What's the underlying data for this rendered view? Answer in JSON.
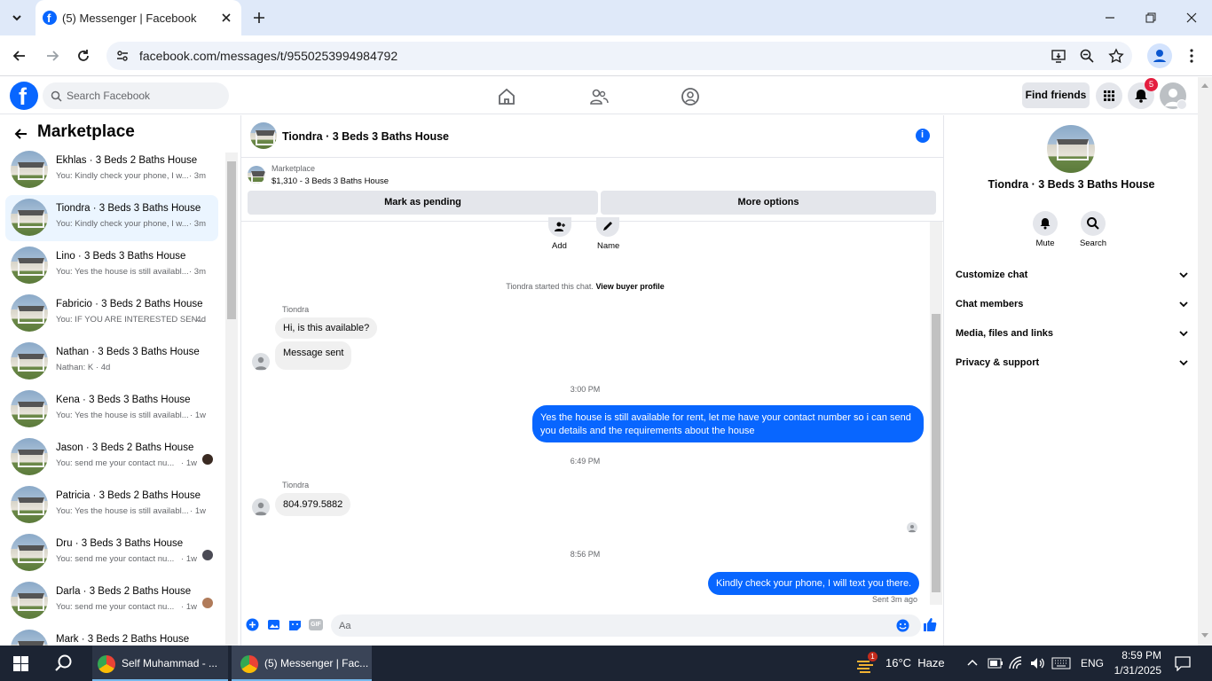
{
  "browser": {
    "tab_title": "(5) Messenger | Facebook",
    "url": "facebook.com/messages/t/9550253994984792"
  },
  "fb": {
    "search_placeholder": "Search Facebook",
    "find_friends": "Find friends",
    "notif_count": "5"
  },
  "left": {
    "title": "Marketplace",
    "conversations": [
      {
        "name": "Ekhlas · 3 Beds 2 Baths House",
        "preview": "You: Kindly check your phone, I w...",
        "time": "· 3m",
        "active": false
      },
      {
        "name": "Tiondra · 3 Beds 3 Baths House",
        "preview": "You: Kindly check your phone, I w...",
        "time": "· 3m",
        "active": true
      },
      {
        "name": "Lino · 3 Beds 3 Baths House",
        "preview": "You: Yes the house is still availabl...",
        "time": "· 3m",
        "active": false
      },
      {
        "name": "Fabricio · 3 Beds 2 Baths House",
        "preview": "You: IF YOU ARE INTERESTED SEN...",
        "time": "· 4d",
        "active": false
      },
      {
        "name": "Nathan · 3 Beds 3 Baths House",
        "preview": "Nathan: K · 4d",
        "time": "",
        "active": false
      },
      {
        "name": "Kena · 3 Beds 3 Baths House",
        "preview": "You: Yes the house is still availabl...",
        "time": "· 1w",
        "active": false
      },
      {
        "name": "Jason · 3 Beds 2 Baths House",
        "preview": "You: send me your contact nu...",
        "time": "· 1w",
        "active": false
      },
      {
        "name": "Patricia · 3 Beds 2 Baths House",
        "preview": "You: Yes the house is still availabl...",
        "time": "· 1w",
        "active": false
      },
      {
        "name": "Dru · 3 Beds 3 Baths House",
        "preview": "You: send me your contact nu...",
        "time": "· 1w",
        "active": false
      },
      {
        "name": "Darla · 3 Beds 2 Baths House",
        "preview": "You: send me your contact nu...",
        "time": "· 1w",
        "active": false
      },
      {
        "name": "Mark · 3 Beds 2 Baths House",
        "preview": "",
        "time": "",
        "active": false
      }
    ]
  },
  "chat": {
    "title": "Tiondra · 3 Beds 3 Baths House",
    "listing_label": "Marketplace",
    "listing_price": "$1,310 - 3 Beds 3 Baths House",
    "mark_pending": "Mark as pending",
    "more_options": "More options",
    "add_label": "Add",
    "name_label": "Name",
    "started_text": "Tiondra started this chat.",
    "view_profile": "View buyer profile",
    "sender_name": "Tiondra",
    "msg1": "Hi, is this available?",
    "msg2": "Message sent",
    "time1": "3:00 PM",
    "msg3": "Yes the house is still available for rent, let me have your contact number so i can send you details and the requirements about the house",
    "time2": "6:49 PM",
    "sender_name2": "Tiondra",
    "msg4": "804.979.5882",
    "time3": "8:56 PM",
    "msg5": "Kindly check your phone, I will text you there.",
    "sent_status": "Sent 3m ago",
    "composer_placeholder": "Aa"
  },
  "right": {
    "title": "Tiondra · 3 Beds 3 Baths House",
    "mute": "Mute",
    "search": "Search",
    "sections": [
      "Customize chat",
      "Chat members",
      "Media, files and links",
      "Privacy & support"
    ]
  },
  "taskbar": {
    "app1": "Self Muhammad - ...",
    "app2": "(5) Messenger | Fac...",
    "weather": "16°C  Haze",
    "lang": "ENG",
    "time": "8:59 PM",
    "date": "1/31/2025",
    "weather_badge": "1"
  },
  "colors": {
    "accent": "#0866ff",
    "fb_blue": "#0866ff",
    "notif_red": "#e41e3f"
  }
}
